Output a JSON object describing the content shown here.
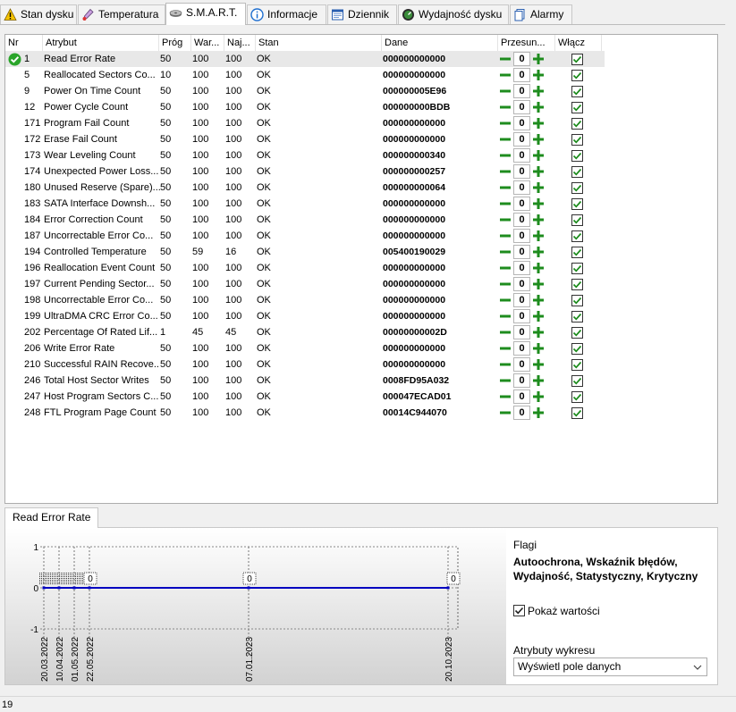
{
  "tabs": [
    {
      "label": "Stan dysku",
      "icon": "warning-icon"
    },
    {
      "label": "Temperatura",
      "icon": "thermometer-icon"
    },
    {
      "label": "S.M.A.R.T.",
      "icon": "smart-icon",
      "active": true
    },
    {
      "label": "Informacje",
      "icon": "info-icon"
    },
    {
      "label": "Dziennik",
      "icon": "log-icon"
    },
    {
      "label": "Wydajność dysku",
      "icon": "gauge-icon"
    },
    {
      "label": "Alarmy",
      "icon": "alarm-icon"
    }
  ],
  "columns": {
    "nr": "Nr",
    "attr": "Atrybut",
    "thresh": "Próg",
    "value": "War...",
    "worst": "Naj...",
    "status": "Stan",
    "data": "Dane",
    "offset": "Przesun...",
    "enable": "Włącz"
  },
  "rows": [
    {
      "nr": "1",
      "attr": "Read Error Rate",
      "thresh": "50",
      "value": "100",
      "worst": "100",
      "status": "OK",
      "data": "000000000000",
      "offset": "0"
    },
    {
      "nr": "5",
      "attr": "Reallocated Sectors Co...",
      "thresh": "10",
      "value": "100",
      "worst": "100",
      "status": "OK",
      "data": "000000000000",
      "offset": "0"
    },
    {
      "nr": "9",
      "attr": "Power On Time Count",
      "thresh": "50",
      "value": "100",
      "worst": "100",
      "status": "OK",
      "data": "000000005E96",
      "offset": "0"
    },
    {
      "nr": "12",
      "attr": "Power Cycle Count",
      "thresh": "50",
      "value": "100",
      "worst": "100",
      "status": "OK",
      "data": "000000000BDB",
      "offset": "0"
    },
    {
      "nr": "171",
      "attr": "Program Fail Count",
      "thresh": "50",
      "value": "100",
      "worst": "100",
      "status": "OK",
      "data": "000000000000",
      "offset": "0"
    },
    {
      "nr": "172",
      "attr": "Erase Fail Count",
      "thresh": "50",
      "value": "100",
      "worst": "100",
      "status": "OK",
      "data": "000000000000",
      "offset": "0"
    },
    {
      "nr": "173",
      "attr": "Wear Leveling Count",
      "thresh": "50",
      "value": "100",
      "worst": "100",
      "status": "OK",
      "data": "000000000340",
      "offset": "0"
    },
    {
      "nr": "174",
      "attr": "Unexpected Power Loss...",
      "thresh": "50",
      "value": "100",
      "worst": "100",
      "status": "OK",
      "data": "000000000257",
      "offset": "0"
    },
    {
      "nr": "180",
      "attr": "Unused Reserve (Spare)...",
      "thresh": "50",
      "value": "100",
      "worst": "100",
      "status": "OK",
      "data": "000000000064",
      "offset": "0"
    },
    {
      "nr": "183",
      "attr": "SATA Interface Downsh...",
      "thresh": "50",
      "value": "100",
      "worst": "100",
      "status": "OK",
      "data": "000000000000",
      "offset": "0"
    },
    {
      "nr": "184",
      "attr": "Error Correction Count",
      "thresh": "50",
      "value": "100",
      "worst": "100",
      "status": "OK",
      "data": "000000000000",
      "offset": "0"
    },
    {
      "nr": "187",
      "attr": "Uncorrectable Error Co...",
      "thresh": "50",
      "value": "100",
      "worst": "100",
      "status": "OK",
      "data": "000000000000",
      "offset": "0"
    },
    {
      "nr": "194",
      "attr": "Controlled Temperature",
      "thresh": "50",
      "value": "59",
      "worst": "16",
      "status": "OK",
      "data": "005400190029",
      "offset": "0"
    },
    {
      "nr": "196",
      "attr": "Reallocation Event Count",
      "thresh": "50",
      "value": "100",
      "worst": "100",
      "status": "OK",
      "data": "000000000000",
      "offset": "0"
    },
    {
      "nr": "197",
      "attr": "Current Pending Sector...",
      "thresh": "50",
      "value": "100",
      "worst": "100",
      "status": "OK",
      "data": "000000000000",
      "offset": "0"
    },
    {
      "nr": "198",
      "attr": "Uncorrectable Error Co...",
      "thresh": "50",
      "value": "100",
      "worst": "100",
      "status": "OK",
      "data": "000000000000",
      "offset": "0"
    },
    {
      "nr": "199",
      "attr": "UltraDMA CRC Error Co...",
      "thresh": "50",
      "value": "100",
      "worst": "100",
      "status": "OK",
      "data": "000000000000",
      "offset": "0"
    },
    {
      "nr": "202",
      "attr": "Percentage Of Rated Lif...",
      "thresh": "1",
      "value": "45",
      "worst": "45",
      "status": "OK",
      "data": "00000000002D",
      "offset": "0"
    },
    {
      "nr": "206",
      "attr": "Write Error Rate",
      "thresh": "50",
      "value": "100",
      "worst": "100",
      "status": "OK",
      "data": "000000000000",
      "offset": "0"
    },
    {
      "nr": "210",
      "attr": "Successful RAIN Recove...",
      "thresh": "50",
      "value": "100",
      "worst": "100",
      "status": "OK",
      "data": "000000000000",
      "offset": "0"
    },
    {
      "nr": "246",
      "attr": "Total Host Sector Writes",
      "thresh": "50",
      "value": "100",
      "worst": "100",
      "status": "OK",
      "data": "0008FD95A032",
      "offset": "0"
    },
    {
      "nr": "247",
      "attr": "Host Program Sectors C...",
      "thresh": "50",
      "value": "100",
      "worst": "100",
      "status": "OK",
      "data": "000047ECAD01",
      "offset": "0"
    },
    {
      "nr": "248",
      "attr": "FTL Program Page Count",
      "thresh": "50",
      "value": "100",
      "worst": "100",
      "status": "OK",
      "data": "00014C944070",
      "offset": "0"
    }
  ],
  "lower": {
    "tab_label": "Read Error Rate",
    "flags_label": "Flagi",
    "flags_line1": "Autoochrona, Wskaźnik błędów,",
    "flags_line2": "Wydajność, Statystyczny, Krytyczny",
    "show_values_label": "Pokaż wartości",
    "show_values_checked": true,
    "chart_attrs_label": "Atrybuty wykresu",
    "chart_attrs_value": "Wyświetl pole danych"
  },
  "chart_data": {
    "type": "line",
    "x": [
      "20.03.2022",
      "10.04.2022",
      "01.05.2022",
      "22.05.2022",
      "07.01.2023",
      "20.10.2023"
    ],
    "series": [
      {
        "values": [
          0,
          0,
          0,
          0,
          0,
          0
        ]
      }
    ],
    "point_labels": [
      "0",
      "0",
      "0"
    ],
    "yticks": [
      "1",
      "0",
      "-1"
    ],
    "ylim": [
      -1,
      1
    ],
    "grid": true,
    "colors": {
      "line": "#0000c0"
    }
  },
  "status": {
    "text": "19"
  },
  "colors": {
    "ok_green": "#2aa52a",
    "btn_green": "#1e8c1e",
    "selection": "#e8e8e8"
  }
}
